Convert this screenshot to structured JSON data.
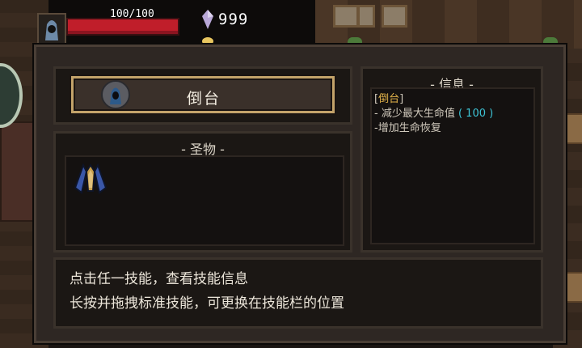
{
  "hud": {
    "hp_text": "100/100",
    "hp_fraction": 1.0,
    "gems_text": "999",
    "colors": {
      "hp": "#c01e2a",
      "gem": "#b9a8d8"
    }
  },
  "skill": {
    "name": "倒台",
    "icon": "hooded-figure-icon"
  },
  "relics": {
    "title": "- 圣物 -",
    "items": [
      {
        "icon": "blue-cloak-relic-icon"
      }
    ]
  },
  "info": {
    "title": "- 信息 -",
    "bracket_open": "[",
    "name": "倒台",
    "bracket_close": "]",
    "line1_prefix": "- 减少最大生命值",
    "line1_open": " ( ",
    "line1_value": "100",
    "line1_close": " )",
    "line2": "-增加生命恢复",
    "colors": {
      "name": "#e2b34a",
      "value": "#3dc4d6"
    }
  },
  "hint": {
    "line1": "点击任一技能，查看技能信息",
    "line2": "长按并拖拽标准技能，可更换在技能栏的位置"
  }
}
